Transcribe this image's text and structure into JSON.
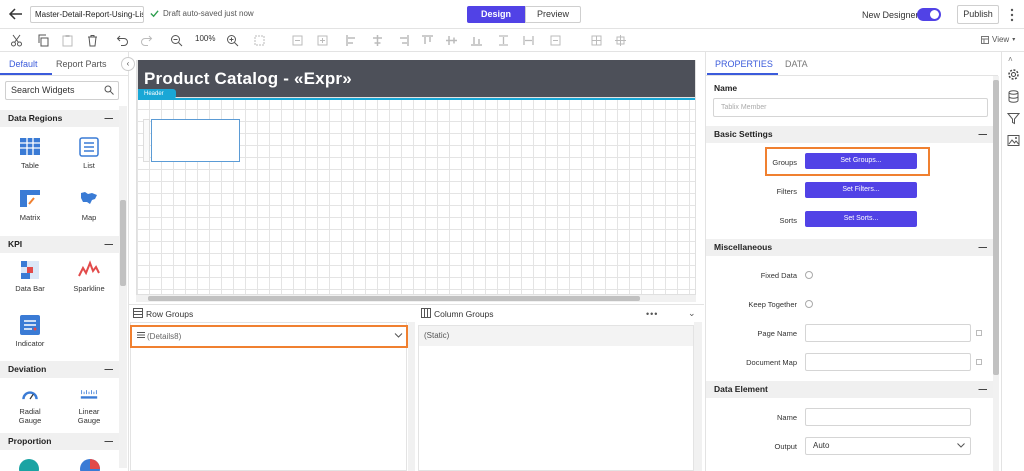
{
  "topbar": {
    "report_name": "Master-Detail-Report-Using-Lis",
    "autosave": "Draft auto-saved just now",
    "design_tab": "Design",
    "preview_tab": "Preview",
    "new_designer": "New Designer",
    "publish": "Publish"
  },
  "toolbar": {
    "zoom": "100%",
    "view": "View"
  },
  "left_panel": {
    "tabs": [
      "Default",
      "Report Parts"
    ],
    "search_placeholder": "Search Widgets",
    "categories": [
      {
        "name": "Data Regions",
        "widgets": [
          "Table",
          "List",
          "Matrix",
          "Map"
        ]
      },
      {
        "name": "KPI",
        "widgets": [
          "Data Bar",
          "Sparkline",
          "Indicator"
        ]
      },
      {
        "name": "Deviation",
        "widgets": [
          "Radial Gauge",
          "Linear Gauge"
        ]
      },
      {
        "name": "Proportion",
        "widgets": []
      }
    ]
  },
  "canvas": {
    "report_title": "Product Catalog - «Expr»",
    "header_tag": "Header"
  },
  "groups": {
    "row_groups_label": "Row Groups",
    "column_groups_label": "Column Groups",
    "row_item": "(Details8)",
    "column_item": "(Static)"
  },
  "properties": {
    "tabs": [
      "PROPERTIES",
      "DATA"
    ],
    "name_label": "Name",
    "name_placeholder": "Tablix Member",
    "basic_settings": "Basic Settings",
    "groups_label": "Groups",
    "groups_button": "Set Groups...",
    "filters_label": "Filters",
    "filters_button": "Set Filters...",
    "sorts_label": "Sorts",
    "sorts_button": "Set Sorts...",
    "miscellaneous": "Miscellaneous",
    "fixed_data": "Fixed Data",
    "keep_together": "Keep Together",
    "page_name": "Page Name",
    "document_map": "Document Map",
    "data_element": "Data Element",
    "de_name": "Name",
    "output_label": "Output",
    "output_value": "Auto"
  },
  "colors": {
    "accent": "#5142e6",
    "highlight": "#f08030",
    "header_bg": "#4d5059",
    "header_line": "#19a7d6"
  },
  "icons": [
    "back-icon",
    "check-icon",
    "cut-icon",
    "copy-icon",
    "paste-icon",
    "delete-icon",
    "undo-icon",
    "redo-icon",
    "zoom-out-icon",
    "zoom-in-icon",
    "gear-icon",
    "database-icon",
    "filter-icon",
    "image-icon"
  ]
}
